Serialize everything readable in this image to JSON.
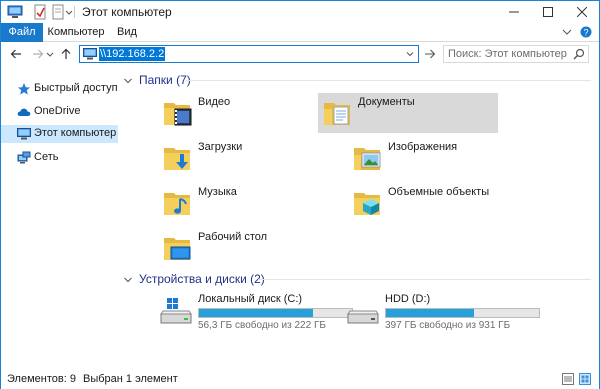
{
  "window": {
    "title": "Этот компьютер"
  },
  "ribbon": {
    "tabs": [
      "Файл",
      "Компьютер",
      "Вид"
    ]
  },
  "address": {
    "value": "\\\\192.168.2.2"
  },
  "search": {
    "placeholder": "Поиск: Этот компьютер"
  },
  "sidebar": {
    "items": [
      {
        "label": "Быстрый доступ",
        "icon": "star-icon"
      },
      {
        "label": "OneDrive",
        "icon": "cloud-icon"
      },
      {
        "label": "Этот компьютер",
        "icon": "computer-icon",
        "selected": true
      },
      {
        "label": "Сеть",
        "icon": "network-icon"
      }
    ]
  },
  "folders_group": {
    "title": "Папки (7)",
    "items": [
      {
        "label": "Видео",
        "icon": "video-folder-icon"
      },
      {
        "label": "Документы",
        "icon": "documents-folder-icon",
        "selected": true
      },
      {
        "label": "Загрузки",
        "icon": "downloads-folder-icon"
      },
      {
        "label": "Изображения",
        "icon": "pictures-folder-icon"
      },
      {
        "label": "Музыка",
        "icon": "music-folder-icon"
      },
      {
        "label": "Объемные объекты",
        "icon": "3d-objects-folder-icon"
      },
      {
        "label": "Рабочий стол",
        "icon": "desktop-folder-icon"
      }
    ]
  },
  "drives_group": {
    "title": "Устройства и диски (2)",
    "items": [
      {
        "name": "Локальный диск (C:)",
        "free": "56,3 ГБ свободно из 222 ГБ",
        "used_fraction": 0.746,
        "icon": "windows-drive-icon"
      },
      {
        "name": "HDD (D:)",
        "free": "397 ГБ свободно из 931 ГБ",
        "used_fraction": 0.574,
        "icon": "hard-drive-icon"
      }
    ]
  },
  "status": {
    "items_count": "Элементов: 9",
    "selected": "Выбран 1 элемент"
  },
  "colors": {
    "accent": "#1979ca",
    "selection": "#cce8ff",
    "drive_bar": "#26a0da",
    "group_title": "#1e3287"
  }
}
